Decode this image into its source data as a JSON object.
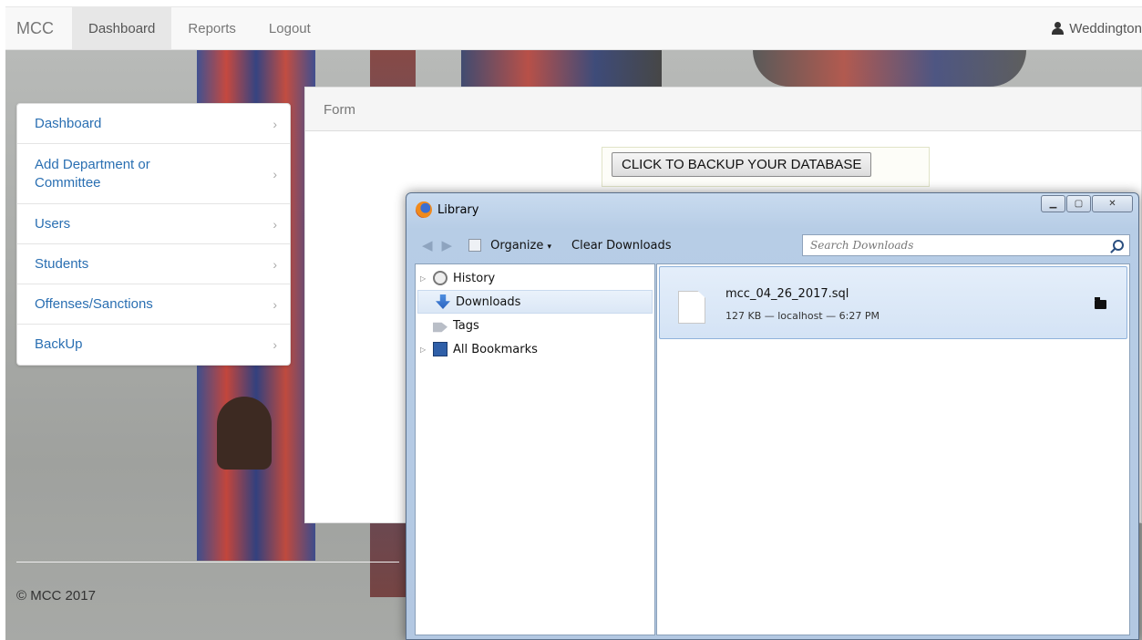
{
  "navbar": {
    "brand": "MCC",
    "links": [
      "Dashboard",
      "Reports",
      "Logout"
    ],
    "active": "Dashboard",
    "user": "Weddington"
  },
  "sidebar": {
    "items": [
      {
        "label": "Dashboard"
      },
      {
        "label": "Add Department or Committee"
      },
      {
        "label": "Users"
      },
      {
        "label": "Students"
      },
      {
        "label": "Offenses/Sanctions"
      },
      {
        "label": "BackUp"
      }
    ],
    "chevron": "›"
  },
  "panel": {
    "heading": "Form",
    "backup_button": "CLICK TO BACKUP YOUR DATABASE"
  },
  "footer": {
    "copyright": "© MCC 2017"
  },
  "library": {
    "title": "Library",
    "toolbar": {
      "organize": "Organize",
      "clear_downloads": "Clear Downloads",
      "search_placeholder": "Search Downloads"
    },
    "tree": [
      {
        "label": "History",
        "icon": "history-icon",
        "expandable": true
      },
      {
        "label": "Downloads",
        "icon": "downloads-icon",
        "expandable": false,
        "selected": true
      },
      {
        "label": "Tags",
        "icon": "tags-icon",
        "expandable": false
      },
      {
        "label": "All Bookmarks",
        "icon": "bookmarks-icon",
        "expandable": true
      }
    ],
    "downloads": [
      {
        "filename": "mcc_04_26_2017.sql",
        "meta": "127 KB — localhost — 6:27 PM"
      }
    ]
  }
}
